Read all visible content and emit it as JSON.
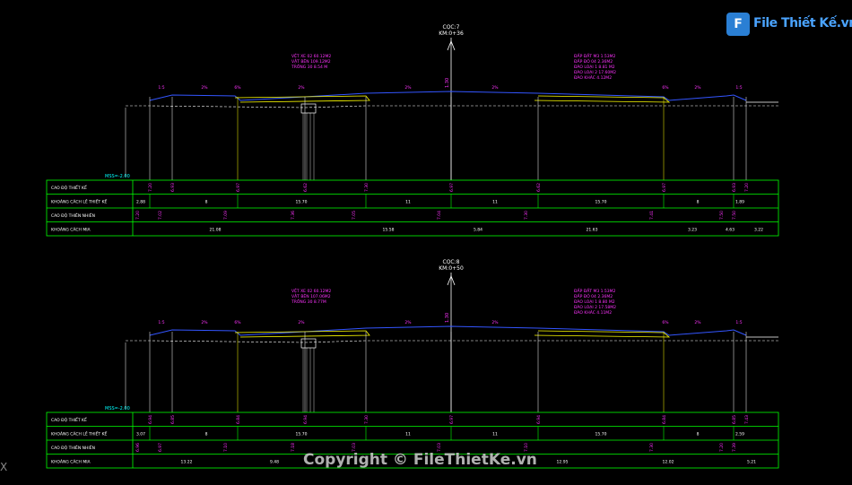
{
  "brand": {
    "logo_mark": "F",
    "logo_text": "File Thiết Kế.vn"
  },
  "watermark": "Copyright © FileThietKe.vn",
  "ucs_mark": "X",
  "colors": {
    "background": "#000000",
    "grid": "#00ff00",
    "label": "#ff33ff",
    "design": "#3355ff",
    "ground": "#ffffff",
    "center": "#00ffff",
    "accent": "#ffff00"
  },
  "row_labels": [
    "CAO ĐỘ THIẾT KẾ",
    "KHOẢNG CÁCH LỀ THIẾT KẾ",
    "CAO ĐỘ THIÊN NHIÊN",
    "KHOẢNG CÁCH MIA"
  ],
  "sections": [
    {
      "name": "CỌC:7",
      "km": "KM:0+36",
      "datum": "MSS=-2.00",
      "slope_labels": [
        "1:5",
        "2%",
        "6%",
        "2%",
        "2%",
        "2%",
        "6%",
        "2%",
        "1:5"
      ],
      "center_elev": "1.30",
      "left_note": [
        "VỆT XE 02  60.12M2",
        "VẬT BÊN    109.12M2",
        "TRỒNG 30   8.54 M"
      ],
      "right_note": [
        "ĐẤP ĐẤT M3   1.53M2",
        "ĐẤP ĐỎ 04   2.36M2",
        "ĐÀO LOẠI 1  8.81 M2",
        "ĐÀO LOẠI 2  17.60M2",
        "ĐÀO KHÁC    4.12M2"
      ],
      "design_elev": [
        "7.20",
        "6.93",
        "6.97",
        "6.62",
        "7.30",
        "6.97",
        "6.62",
        "6.97",
        "6.93",
        "7.20"
      ],
      "edge_dist": [
        "2.88",
        "8",
        "15.70",
        "11",
        "11",
        "15.70",
        "8",
        "1.89"
      ],
      "natural_elev": [
        "7.20",
        "7.02",
        "7.09",
        "7.36",
        "7.05",
        "7.04",
        "7.30",
        "7.41",
        "7.50",
        "7.50"
      ],
      "staff_dist": [
        "21.08",
        "15.58",
        "5.84",
        "21.63",
        "3.23",
        "4.63",
        "3.22"
      ]
    },
    {
      "name": "CỌC:8",
      "km": "KM:0+50",
      "datum": "MSS=-2.00",
      "slope_labels": [
        "1:5",
        "2%",
        "6%",
        "2%",
        "2%",
        "2%",
        "6%",
        "2%",
        "1:5"
      ],
      "center_elev": "1.30",
      "left_note": [
        "VỆT XE 02  60.12M2",
        "VẬT BÊN    107.06M2",
        "TRỒNG 30   8.77M"
      ],
      "right_note": [
        "ĐẤP ĐẤT M3   1.53M2",
        "ĐẤP ĐỎ 04   2.36M2",
        "ĐÀO LOẠI 1  8.80 M2",
        "ĐÀO LOẠI 2  17.58M2",
        "ĐÀO KHÁC    4.11M2"
      ],
      "design_elev": [
        "6.94",
        "6.85",
        "6.84",
        "6.94",
        "7.30",
        "6.97",
        "6.94",
        "6.84",
        "6.85",
        "7.43"
      ],
      "edge_dist": [
        "3.07",
        "8",
        "15.70",
        "11",
        "11",
        "15.70",
        "8",
        "2.59"
      ],
      "natural_elev": [
        "6.96",
        "6.97",
        "7.10",
        "7.18",
        "7.03",
        "7.03",
        "7.10",
        "7.30",
        "7.20",
        "7.39"
      ],
      "staff_dist": [
        "13.22",
        "9.48",
        "12.95",
        "12.02",
        "5.21"
      ]
    }
  ]
}
